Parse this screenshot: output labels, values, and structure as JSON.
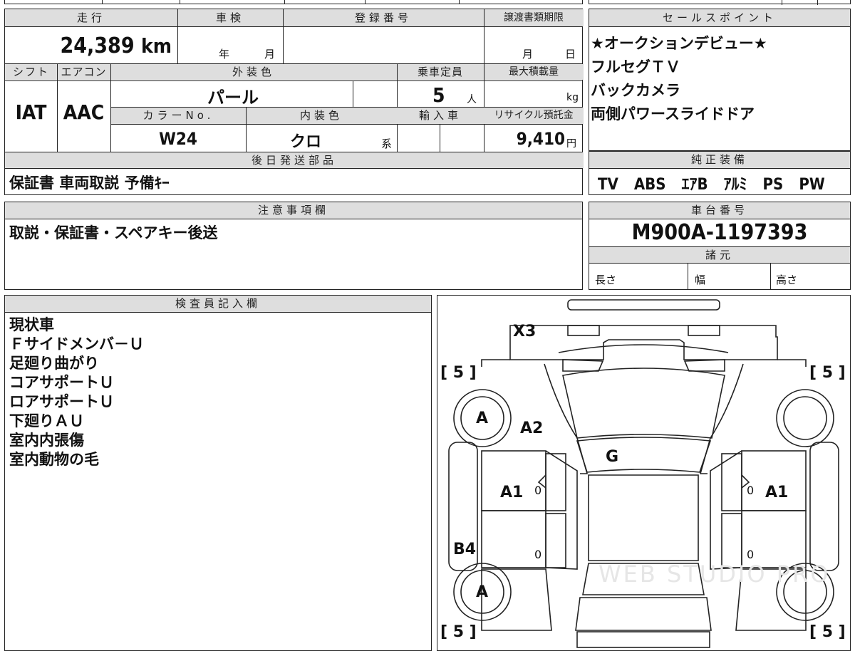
{
  "top_stub": {
    "partial_text_1": "",
    "partial_text_2": ""
  },
  "mileage": {
    "header": "走行",
    "value": "24,389",
    "unit": "km"
  },
  "inspection": {
    "header": "車検",
    "year_unit": "年",
    "month_unit": "月"
  },
  "registration": {
    "header": "登録番号"
  },
  "transfer_deadline": {
    "header": "譲渡書類期限",
    "month_unit": "月",
    "day_unit": "日"
  },
  "shift": {
    "header": "シフト",
    "value": "IAT"
  },
  "aircon": {
    "header": "エアコン",
    "value": "AAC"
  },
  "exterior_color": {
    "header": "外装色",
    "value": "パール"
  },
  "capacity": {
    "header": "乗車定員",
    "value": "5",
    "unit": "人"
  },
  "max_load": {
    "header": "最大積載量",
    "unit": "kg"
  },
  "color_no": {
    "header": "カラーNo.",
    "value": "W24"
  },
  "interior_color": {
    "header": "内装色",
    "value": "クロ",
    "suffix": "系"
  },
  "import": {
    "header": "輸入車"
  },
  "recycle_fee": {
    "header": "リサイクル預託金",
    "value": "9,410",
    "unit": "円"
  },
  "later_parts": {
    "header": "後日発送部品",
    "value": "保証書 車両取説 予備ｷｰ"
  },
  "sales_points": {
    "header": "セールスポイント",
    "lines": [
      "★オークションデビュー★",
      "フルセグＴＶ",
      "バックカメラ",
      "両側パワースライドドア"
    ]
  },
  "genuine_equipment": {
    "header": "純正装備",
    "value": "TV　ABS　ｴｱB　ｱﾙﾐ　PS　PW"
  },
  "caution": {
    "header": "注意事項欄",
    "value": "取説・保証書・スペアキー後送"
  },
  "chassis_number": {
    "header": "車台番号",
    "value": "M900A-1197393"
  },
  "specs": {
    "header": "諸元",
    "length": "長さ",
    "width": "幅",
    "height": "高さ"
  },
  "inspector": {
    "header": "検査員記入欄",
    "lines": [
      "現状車",
      "Ｆサイドメンバ－Ｕ",
      "足廻り曲がり",
      "コアサポートＵ",
      "ロアサポートＵ",
      "下廻りＡＵ",
      "室内内張傷",
      "室内動物の毛"
    ]
  },
  "diagram": {
    "tire_fl": "[ 5 ]",
    "tire_fr": "[ 5 ]",
    "tire_rl": "[ 5 ]",
    "tire_rr": "[ 5 ]",
    "front_bumper_mark": "X3",
    "front_left_wheel_mark": "A",
    "rear_left_wheel_mark": "A",
    "front_fender_mark": "A2",
    "windshield_mark": "G",
    "left_front_door_mark": "A1",
    "right_front_door_mark": "A1",
    "left_rear_panel_mark": "B4",
    "zero_1": "0",
    "zero_2": "0",
    "zero_3": "0",
    "zero_4": "0",
    "watermark": "WEB STUDIO PRO"
  }
}
